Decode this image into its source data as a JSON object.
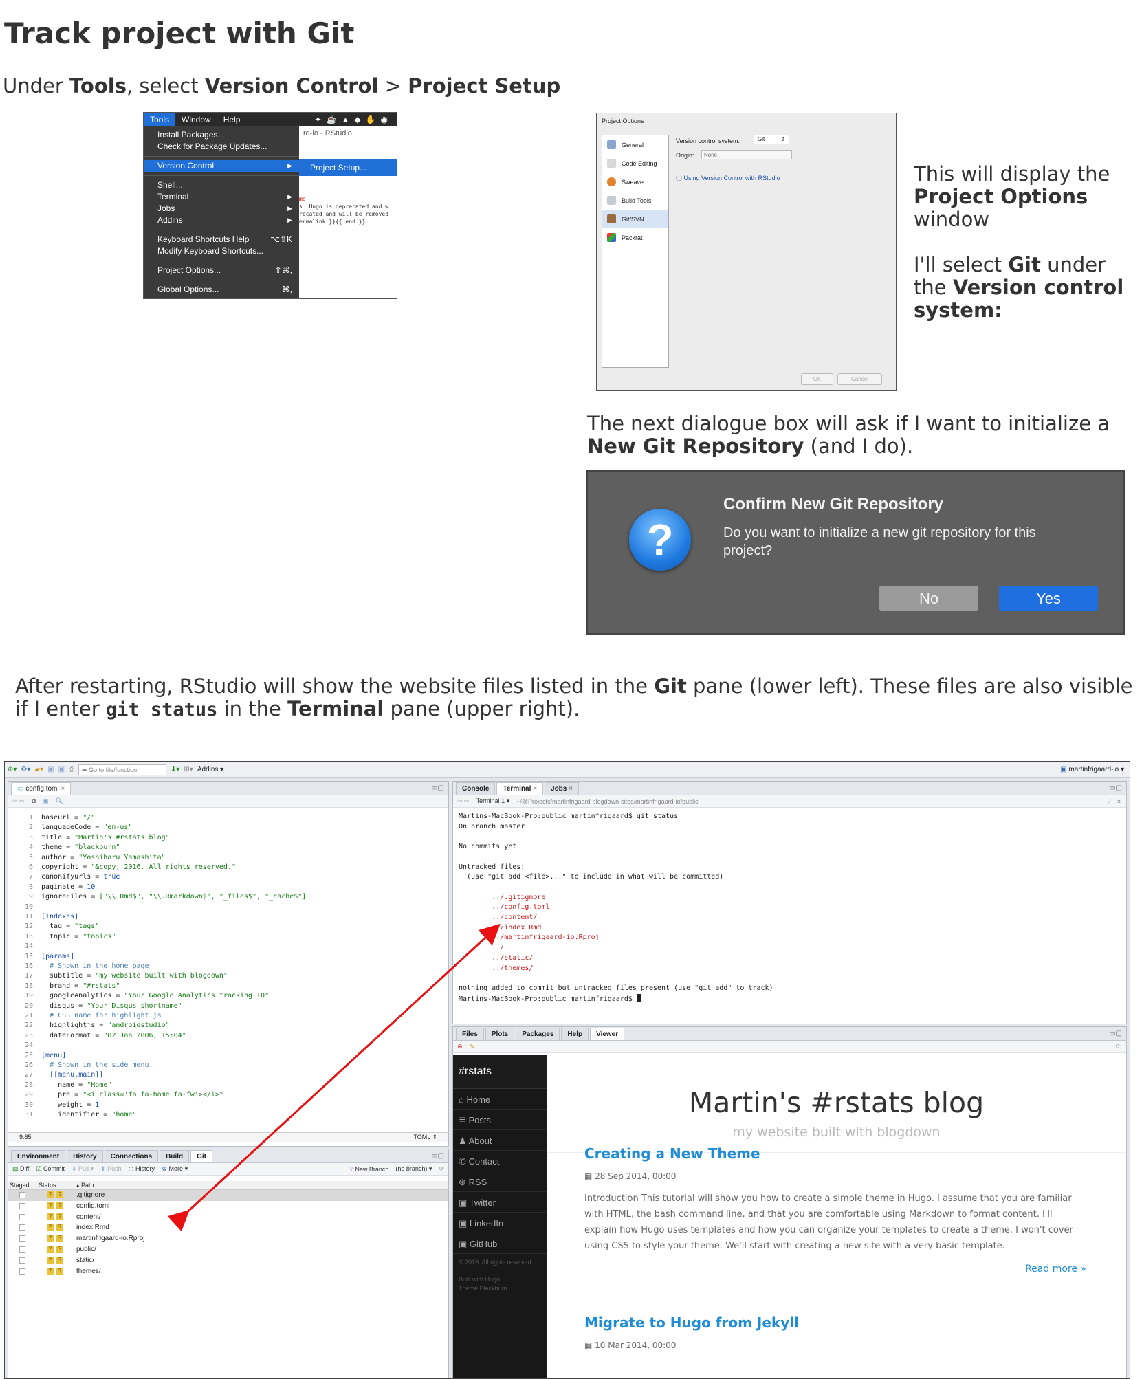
{
  "heading": "Track project with Git",
  "intro": {
    "prefix": "Under ",
    "tools": "Tools",
    "mid": ", select ",
    "version_control": "Version Control",
    "sep": " > ",
    "project_setup": "Project Setup"
  },
  "tools_menu": {
    "menubar": [
      "Tools",
      "Window",
      "Help"
    ],
    "window_title_fragment": "rd-io - RStudio",
    "items": [
      {
        "label": "Install Packages..."
      },
      {
        "label": "Check for Package Updates..."
      },
      {
        "label": "Version Control"
      },
      {
        "label": "Shell..."
      },
      {
        "label": "Terminal"
      },
      {
        "label": "Jobs"
      },
      {
        "label": "Addins"
      },
      {
        "label": "Keyboard Shortcuts Help",
        "shortcut": "⌥⇧K"
      },
      {
        "label": "Modify Keyboard Shortcuts..."
      },
      {
        "label": "Project Options...",
        "shortcut": "⇧⌘,"
      },
      {
        "label": "Global Options...",
        "shortcut": "⌘,"
      }
    ],
    "submenu_item": "Project Setup...",
    "behind_lines": [
      "md",
      "s .Hugo is deprecated and w",
      "recated and will be removed",
      "ermalink }}{{ end }}."
    ]
  },
  "project_options": {
    "title": "Project Options",
    "sidebar": [
      "General",
      "Code Editing",
      "Sweave",
      "Build Tools",
      "Git/SVN",
      "Packrat"
    ],
    "vcs_label": "Version control system:",
    "vcs_value": "Git",
    "origin_label": "Origin:",
    "origin_value": "None",
    "help_link": "Using Version Control with RStudio",
    "ok": "OK",
    "cancel": "Cancel"
  },
  "side_text": {
    "line1": "This will display the ",
    "project_options": "Project Options",
    "line1b": " window",
    "line2a": "I'll select ",
    "git": "Git",
    "line2b": " under the ",
    "vcs": "Version control system:"
  },
  "dialog_intro": {
    "a": "The next dialogue box will ask if I want to initialize a ",
    "b": "New Git Repository",
    "c": " (and I do)."
  },
  "confirm": {
    "title": "Confirm New Git Repository",
    "message": "Do you want to initialize a new git repository for this project?",
    "no": "No",
    "yes": "Yes",
    "icon": "question-icon"
  },
  "after": {
    "a": "After restarting, RStudio will show the website files listed in the ",
    "git": "Git",
    "b": " pane (lower left). These files are also visible if I enter ",
    "cmd": "git status",
    "c": " in the ",
    "terminal": "Terminal",
    "d": " pane (upper right)."
  },
  "rstudio": {
    "goto_placeholder": "Go to file/function",
    "addins": "Addins",
    "project": "martinfrigaard-io",
    "editor_tab": "config.toml",
    "cursor_pos": "9:65",
    "file_type": "TOML",
    "code_lines": [
      {
        "n": "1",
        "k": "baseurl = ",
        "v": "\"/\"",
        "t": "str"
      },
      {
        "n": "2",
        "k": "languageCode = ",
        "v": "\"en-us\"",
        "t": "str"
      },
      {
        "n": "3",
        "k": "title = ",
        "v": "\"Martin's #rstats blog\"",
        "t": "str"
      },
      {
        "n": "4",
        "k": "theme = ",
        "v": "\"blackburn\"",
        "t": "str"
      },
      {
        "n": "5",
        "k": "author = ",
        "v": "\"Yoshiharu Yamashita\"",
        "t": "str"
      },
      {
        "n": "6",
        "k": "copyright = ",
        "v": "\"&copy; 2016. All rights reserved.\"",
        "t": "str"
      },
      {
        "n": "7",
        "k": "canonifyurls = ",
        "v": "true",
        "t": "kw"
      },
      {
        "n": "8",
        "k": "paginate = ",
        "v": "10",
        "t": "kw"
      },
      {
        "n": "9",
        "k": "ignoreFiles = ",
        "v": "[\"\\\\.Rmd$\", \"\\\\.Rmarkdown$\", \"_files$\", \"_cache$\"]",
        "t": "str"
      },
      {
        "n": "10",
        "k": "",
        "v": "",
        "t": ""
      },
      {
        "n": "11",
        "k": "",
        "v": "[indexes]",
        "t": "kw"
      },
      {
        "n": "12",
        "k": "  tag = ",
        "v": "\"tags\"",
        "t": "str"
      },
      {
        "n": "13",
        "k": "  topic = ",
        "v": "\"topics\"",
        "t": "str"
      },
      {
        "n": "14",
        "k": "",
        "v": "",
        "t": ""
      },
      {
        "n": "15",
        "k": "",
        "v": "[params]",
        "t": "kw"
      },
      {
        "n": "16",
        "k": "  ",
        "v": "# Shown in the home page",
        "t": "cmt"
      },
      {
        "n": "17",
        "k": "  subtitle = ",
        "v": "\"my website built with blogdown\"",
        "t": "str"
      },
      {
        "n": "18",
        "k": "  brand = ",
        "v": "\"#rstats\"",
        "t": "str"
      },
      {
        "n": "19",
        "k": "  googleAnalytics = ",
        "v": "\"Your Google Analytics tracking ID\"",
        "t": "str"
      },
      {
        "n": "20",
        "k": "  disqus = ",
        "v": "\"Your Disqus shortname\"",
        "t": "str"
      },
      {
        "n": "21",
        "k": "  ",
        "v": "# CSS name for highlight.js",
        "t": "cmt"
      },
      {
        "n": "22",
        "k": "  highlightjs = ",
        "v": "\"androidstudio\"",
        "t": "str"
      },
      {
        "n": "23",
        "k": "  dateFormat = ",
        "v": "\"02 Jan 2006, 15:04\"",
        "t": "str"
      },
      {
        "n": "24",
        "k": "",
        "v": "",
        "t": ""
      },
      {
        "n": "25",
        "k": "",
        "v": "[menu]",
        "t": "kw"
      },
      {
        "n": "26",
        "k": "  ",
        "v": "# Shown in the side menu.",
        "t": "cmt"
      },
      {
        "n": "27",
        "k": "  ",
        "v": "[[menu.main]]",
        "t": "kw"
      },
      {
        "n": "28",
        "k": "    name = ",
        "v": "\"Home\"",
        "t": "str"
      },
      {
        "n": "29",
        "k": "    pre = ",
        "v": "\"<i class='fa fa-home fa-fw'></i>\"",
        "t": "str"
      },
      {
        "n": "30",
        "k": "    weight = ",
        "v": "1",
        "t": "kw"
      },
      {
        "n": "31",
        "k": "    identifier = ",
        "v": "\"home\"",
        "t": "str"
      }
    ],
    "env_tabs": [
      "Environment",
      "History",
      "Connections",
      "Build",
      "Git"
    ],
    "git_toolbar": [
      "Diff",
      "Commit",
      "Pull",
      "Push",
      "History",
      "More",
      "New Branch",
      "(no branch)"
    ],
    "git_headers": [
      "Staged",
      "Status",
      "Path"
    ],
    "git_files": [
      ".gitignore",
      "config.toml",
      "content/",
      "index.Rmd",
      "martinfrigaard-io.Rproj",
      "public/",
      "static/",
      "themes/"
    ],
    "term_tabs": [
      "Console",
      "Terminal",
      "Jobs"
    ],
    "term_selector": "Terminal 1",
    "term_path": "~/@Projects/martinfrigaard-blogdown-sites/martinfrigaard-io/public",
    "term_lines": [
      "Martins-MacBook-Pro:public martinfrigaard$ git status",
      "On branch master",
      "",
      "No commits yet",
      "",
      "Untracked files:",
      "  (use \"git add <file>...\" to include in what will be committed)",
      ""
    ],
    "term_untracked": [
      "../.gitignore",
      "../config.toml",
      "../content/",
      "../index.Rmd",
      "../martinfrigaard-io.Rproj",
      "../",
      "../static/",
      "../themes/"
    ],
    "term_end": [
      "nothing added to commit but untracked files present (use \"git add\" to track)",
      "Martins-MacBook-Pro:public martinfrigaard$ "
    ],
    "viewer_tabs": [
      "Files",
      "Plots",
      "Packages",
      "Help",
      "Viewer"
    ],
    "blog": {
      "brand": "#rstats",
      "nav": [
        "Home",
        "Posts",
        "About",
        "Contact",
        "RSS",
        "Twitter",
        "LinkedIn",
        "GitHub"
      ],
      "copyright": "© 2016. All rights reserved.",
      "built_with": "Built with  Hugo",
      "theme": "Theme  Blackburn",
      "title": "Martin's #rstats blog",
      "subtitle": "my website built with blogdown",
      "posts": [
        {
          "title": "Creating a New Theme",
          "date": "28 Sep 2014, 00:00",
          "body": "Introduction This tutorial will show you how to create a simple theme in Hugo. I assume that you are familiar with HTML, the bash command line, and that you are comfortable using Markdown to format content. I'll explain how Hugo uses templates and how you can organize your templates to create a theme. I won't cover using CSS to style your theme. We'll start with creating a new site with a very basic template.",
          "more": "Read more »"
        },
        {
          "title": "Migrate to Hugo from Jekyll",
          "date": "10 Mar 2014, 00:00"
        }
      ]
    },
    "arrow_color": "#e81010"
  }
}
